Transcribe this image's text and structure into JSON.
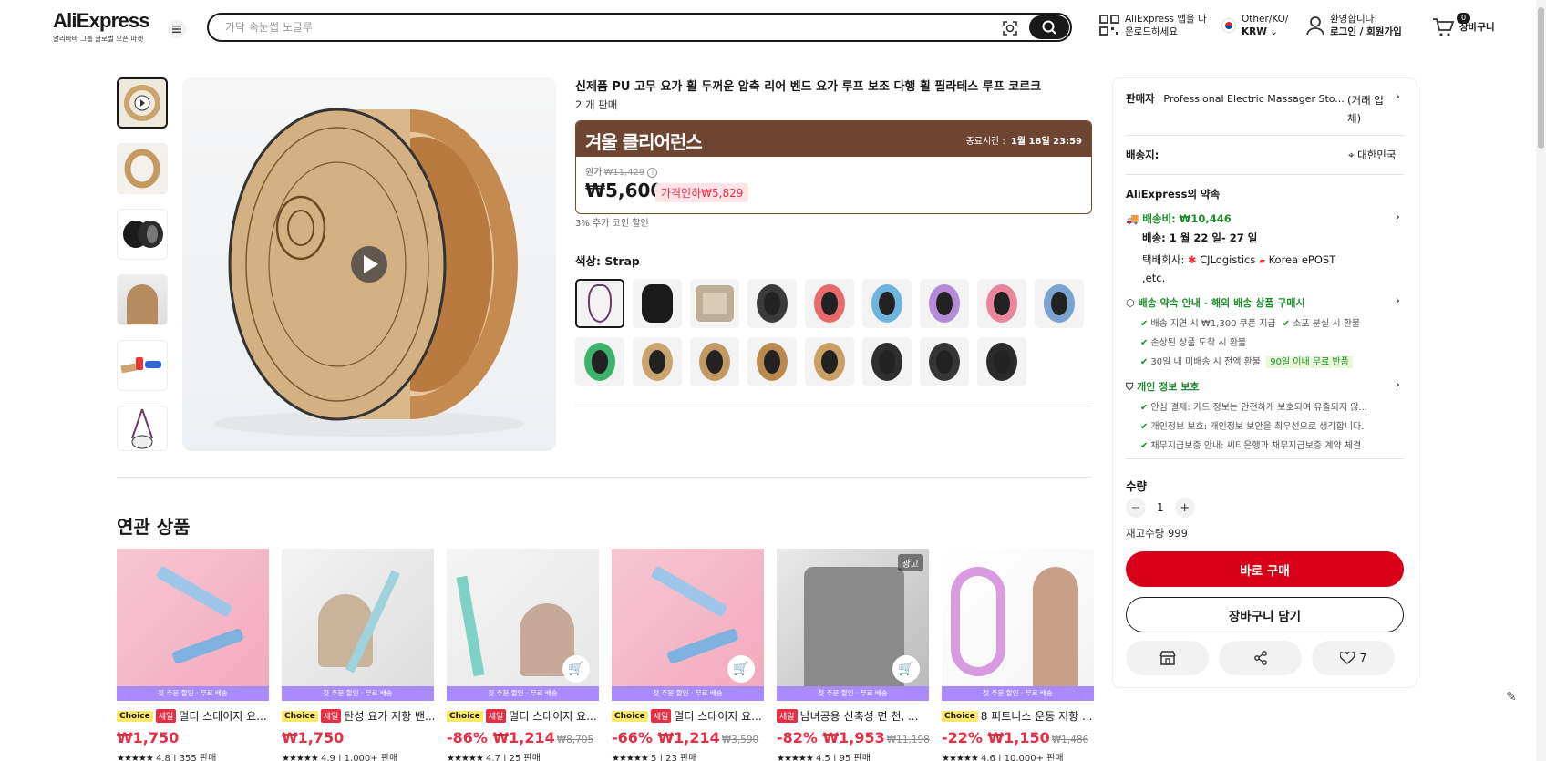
{
  "header": {
    "logo": "AliExpress",
    "logo_sub": "알리바바 그룹 글로벌 오픈 마켓",
    "search_placeholder": "가닥 속눈썹 노글루",
    "app_line1": "AliExpress 앱을 다",
    "app_line2": "운로드하세요",
    "region_line1": "Other/KO/",
    "region_line2": "KRW",
    "account_line1": "환영합니다!",
    "account_line2": "로그인 / 회원가입",
    "cart_count": "0",
    "cart_label": "장바구니"
  },
  "product": {
    "title": "신제품 PU 고무 요가 휠 두꺼운 압축 리어 벤드 요가 루프 보조 다행 휠 필라테스 루프 코르크",
    "sold": "2 개 판매",
    "promo_title": "겨울 클리어런스",
    "promo_end_label": "종료시간 :",
    "promo_end_time": "1월 18일 23:59",
    "orig_label": "원가",
    "orig_price": "₩11,429",
    "price": "₩5,600",
    "discount": "가격인하₩5,829",
    "coin": "3% 추가 코인 할인",
    "color_label": "색상: Strap",
    "swatch_colors": [
      "#f5f5f5",
      "#1a1a1a",
      "#d9cbb8",
      "#3a3a3a",
      "#e86a6a",
      "#6db4de",
      "#b58ad9",
      "#e8869e",
      "#7aa3cf",
      "#3bb36a",
      "#c9a46c",
      "#c09a62",
      "#b88a4e",
      "#c9a062",
      "#2e2e2e",
      "#353535",
      "#2a2a2a"
    ]
  },
  "panel": {
    "seller_label": "판매자",
    "seller_name": "Professional Electric Massager Sto...",
    "seller_note": "(거래 업체)",
    "ship_to_label": "배송지:",
    "ship_to_value": "대한민국",
    "promise_title": "AliExpress의 약속",
    "shipping_fee": "배송비: ₩10,446",
    "delivery": "배송: 1 월 22 일- 27 일",
    "carrier_label": "택배회사:",
    "carrier_1": "CJLogistics",
    "carrier_2": "Korea",
    "carrier_3": "ePOST ,etc.",
    "guarantee_title": "배송 약속 안내 - 해외 배송 상품 구매시",
    "guarantee_1": "배송 지연 시 ₩1,300 쿠폰 지급",
    "guarantee_2": "소포 분실 시 환불",
    "guarantee_3": "손상된 상품 도착 시 환불",
    "guarantee_4": "30일 내 미배송 시 전액 환불",
    "guarantee_badge": "90일 이내 무료 반품",
    "privacy_title": "개인 정보 보호",
    "privacy_1": "안심 결제: 카드 정보는 안전하게 보호되며 유출되지 않...",
    "privacy_2": "개인정보 보호: 개인정보 보안을 최우선으로 생각합니다.",
    "privacy_3": "채무지급보증 안내: 씨티은행과 채무지급보증 계약 체결",
    "qty_label": "수량",
    "qty_minus": "−",
    "qty_value": "1",
    "qty_plus": "+",
    "stock": "재고수량 999",
    "buy_now": "바로 구매",
    "add_cart": "장바구니 담기",
    "wish_count": "7"
  },
  "related": {
    "title": "연관 상품",
    "banner": "첫 주문 할인 · 무료 배송",
    "ad_label": "광고",
    "choice_label": "Choice",
    "sale_label": "세일",
    "items": [
      {
        "name": "멀티 스테이지 요...",
        "choice": true,
        "sale": true,
        "price": "₩1,750",
        "pct": "",
        "orig": "",
        "rating": "4.8",
        "sold": "355 판매"
      },
      {
        "name": "탄성 요가 저항 밴...",
        "choice": true,
        "sale": true,
        "price": "₩1,750",
        "pct": "",
        "orig": "",
        "rating": "4.9",
        "sold": "1,000+ 판매"
      },
      {
        "name": "멀티 스테이지 요...",
        "choice": true,
        "sale": true,
        "price": "₩1,214",
        "pct": "-86%",
        "orig": "₩8,705",
        "rating": "4.7",
        "sold": "25 판매"
      },
      {
        "name": "멀티 스테이지 요...",
        "choice": true,
        "sale": true,
        "price": "₩1,214",
        "pct": "-66%",
        "orig": "₩3,590",
        "rating": "5",
        "sold": "23 판매"
      },
      {
        "name": "남녀공용 신축성 면 천, ...",
        "choice": false,
        "sale": true,
        "price": "₩1,953",
        "pct": "-82%",
        "orig": "₩11,198",
        "rating": "4.5",
        "sold": "95 판매"
      },
      {
        "name": "8 피트니스 운동 저항 ...",
        "choice": true,
        "sale": false,
        "price": "₩1,150",
        "pct": "-22%",
        "orig": "₩1,486",
        "rating": "4.6",
        "sold": "10,000+ 판매"
      }
    ]
  }
}
